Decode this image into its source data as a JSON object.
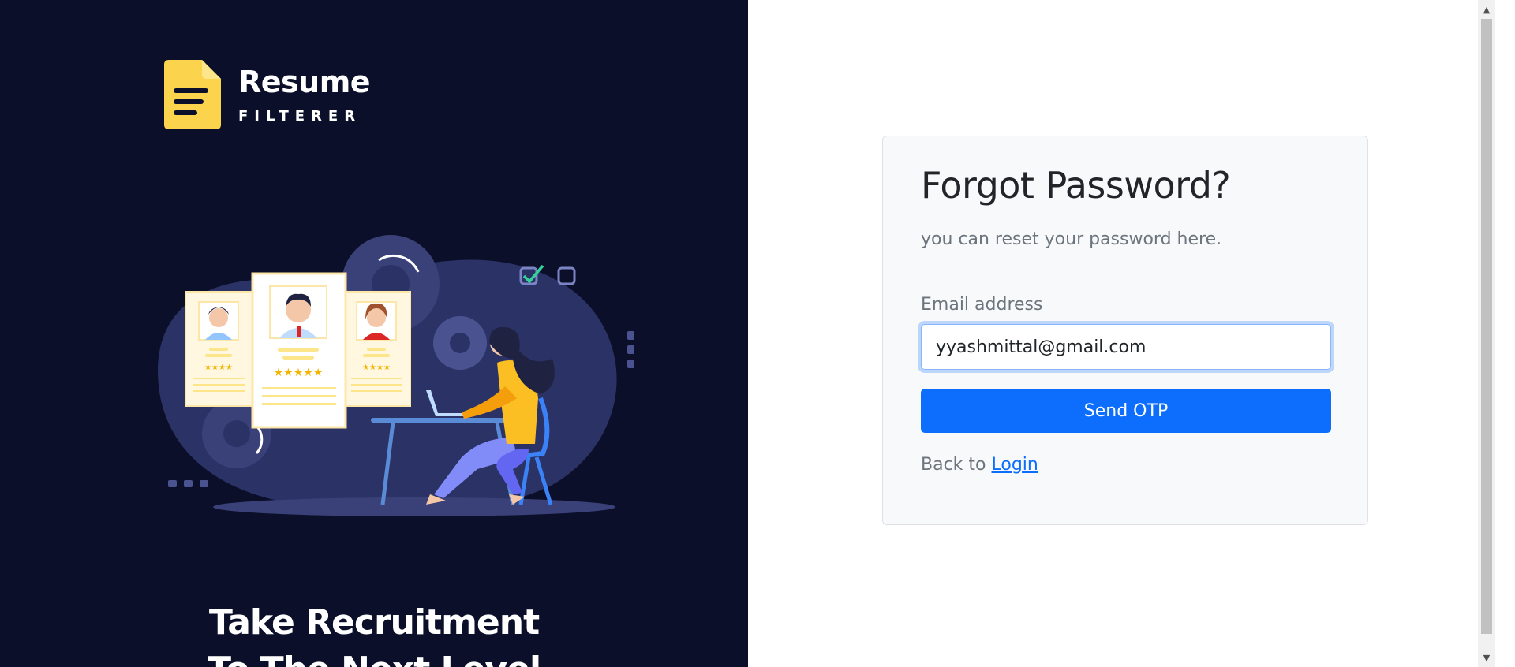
{
  "brand": {
    "name": "Resume",
    "subname": "FILTERER",
    "logo_color": "#fcd34d"
  },
  "left_panel": {
    "tagline_line1": "Take Recruitment",
    "tagline_line2": "To The Next Level",
    "background": "#0b0f29"
  },
  "form": {
    "title": "Forgot Password?",
    "subtitle": "you can reset your password here.",
    "email_label": "Email address",
    "email_value": "yyashmittal@gmail.com",
    "submit_label": "Send OTP",
    "back_text": "Back to",
    "login_link": "Login",
    "accent": "#0d6efd"
  }
}
